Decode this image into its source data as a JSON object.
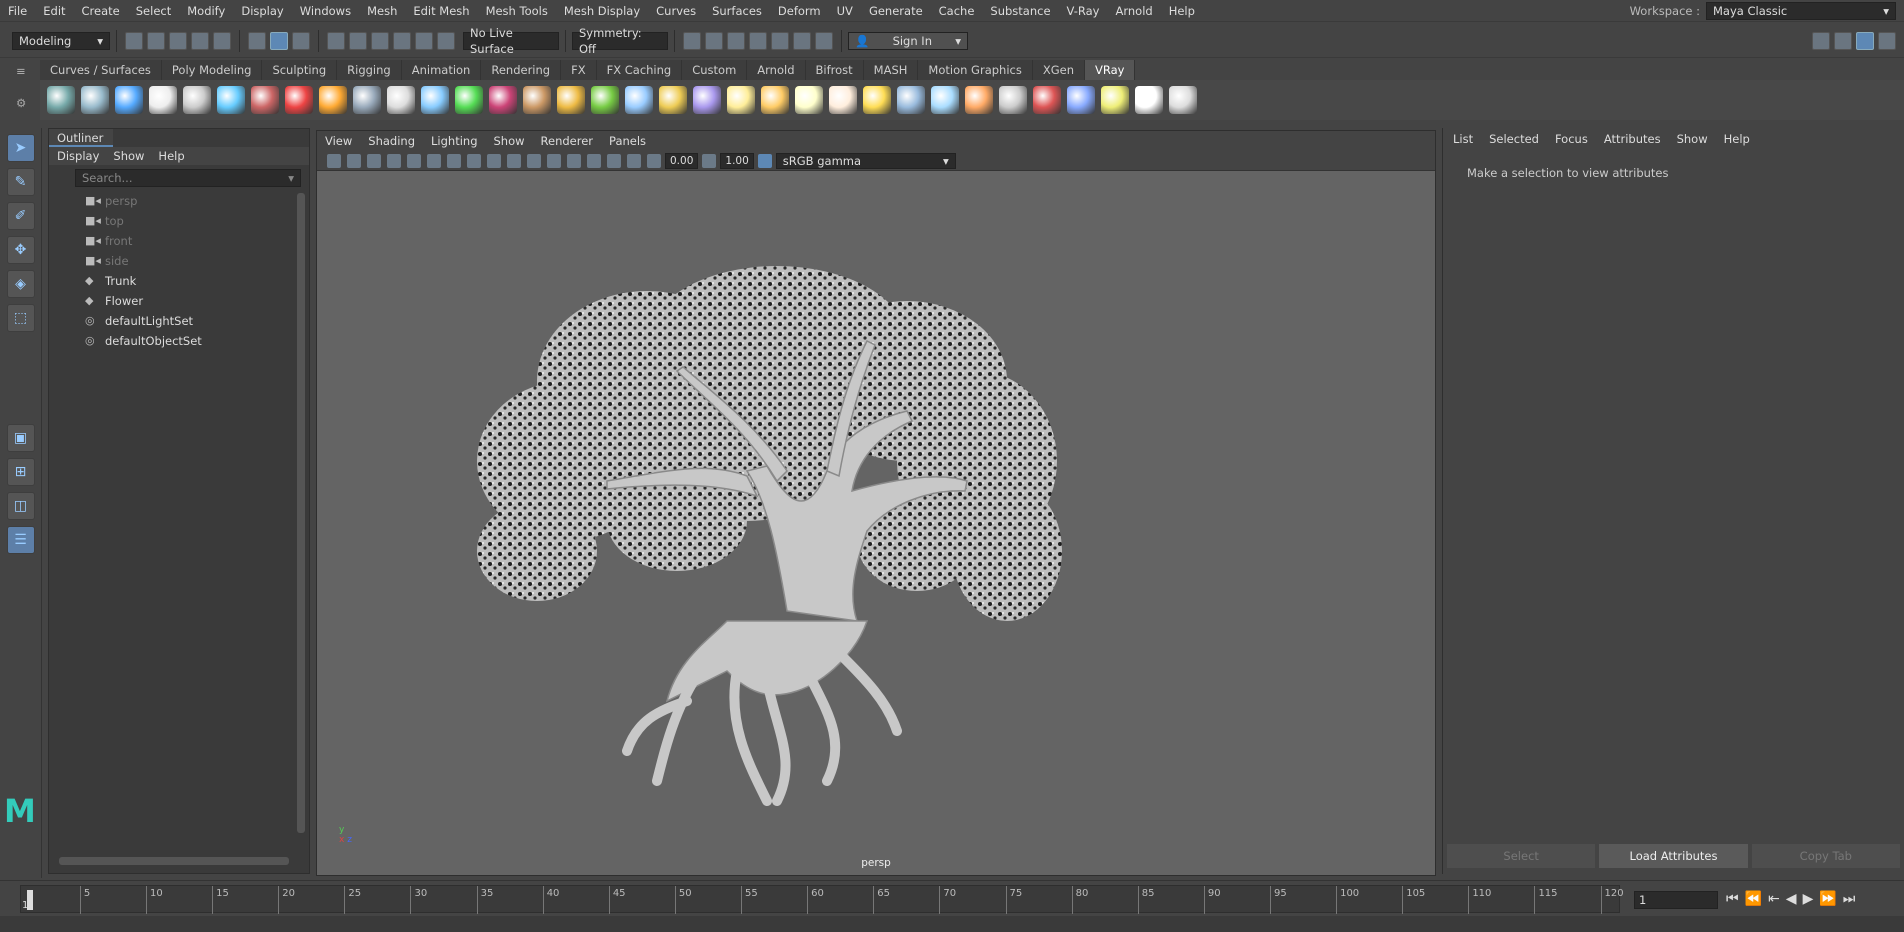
{
  "menubar": {
    "items": [
      "File",
      "Edit",
      "Create",
      "Select",
      "Modify",
      "Display",
      "Windows",
      "Mesh",
      "Edit Mesh",
      "Mesh Tools",
      "Mesh Display",
      "Curves",
      "Surfaces",
      "Deform",
      "UV",
      "Generate",
      "Cache",
      "Substance",
      "V-Ray",
      "Arnold",
      "Help"
    ],
    "workspace_label": "Workspace :",
    "workspace_value": "Maya Classic"
  },
  "statusline": {
    "mode": "Modeling",
    "live_surface": "No Live Surface",
    "symmetry": "Symmetry: Off",
    "sign_in": "Sign In"
  },
  "shelf": {
    "tabs": [
      "Curves / Surfaces",
      "Poly Modeling",
      "Sculpting",
      "Rigging",
      "Animation",
      "Rendering",
      "FX",
      "FX Caching",
      "Custom",
      "Arnold",
      "Bifrost",
      "MASH",
      "Motion Graphics",
      "XGen",
      "VRay"
    ],
    "active_tab": "VRay",
    "icon_colors": [
      "#7aa",
      "#9bc",
      "#5af",
      "#eee",
      "#ccc",
      "#6cf",
      "#c66",
      "#e44",
      "#fa3",
      "#9ab",
      "#ddd",
      "#8cf",
      "#5d5",
      "#c47",
      "#c96",
      "#eb4",
      "#7c4",
      "#9cf",
      "#ec5",
      "#a9e",
      "#fe9",
      "#fc6",
      "#ffc",
      "#fed",
      "#fd5",
      "#9bd",
      "#adf",
      "#fa6",
      "#ccc",
      "#d55",
      "#8af",
      "#ee7",
      "#fff",
      "#ddd"
    ]
  },
  "outliner": {
    "title": "Outliner",
    "menus": [
      "Display",
      "Show",
      "Help"
    ],
    "search_placeholder": "Search...",
    "items": [
      {
        "label": "persp",
        "type": "camera",
        "dim": true
      },
      {
        "label": "top",
        "type": "camera",
        "dim": true
      },
      {
        "label": "front",
        "type": "camera",
        "dim": true
      },
      {
        "label": "side",
        "type": "camera",
        "dim": true
      },
      {
        "label": "Trunk",
        "type": "mesh",
        "dim": false
      },
      {
        "label": "Flower",
        "type": "mesh",
        "dim": false
      },
      {
        "label": "defaultLightSet",
        "type": "set",
        "dim": false
      },
      {
        "label": "defaultObjectSet",
        "type": "set",
        "dim": false
      }
    ]
  },
  "viewport": {
    "menus": [
      "View",
      "Shading",
      "Lighting",
      "Show",
      "Renderer",
      "Panels"
    ],
    "exposure": "0.00",
    "gamma": "1.00",
    "colorspace": "sRGB gamma",
    "camera_label": "persp"
  },
  "attribute_editor": {
    "menus": [
      "List",
      "Selected",
      "Focus",
      "Attributes",
      "Show",
      "Help"
    ],
    "message": "Make a selection to view attributes",
    "buttons": [
      "Select",
      "Load Attributes",
      "Copy Tab"
    ]
  },
  "timeline": {
    "ticks": [
      "5",
      "10",
      "15",
      "20",
      "25",
      "30",
      "35",
      "40",
      "45",
      "50",
      "55",
      "60",
      "65",
      "70",
      "75",
      "80",
      "85",
      "90",
      "95",
      "100",
      "105",
      "110",
      "115",
      "120"
    ],
    "start": "1",
    "current_frame": "1"
  }
}
